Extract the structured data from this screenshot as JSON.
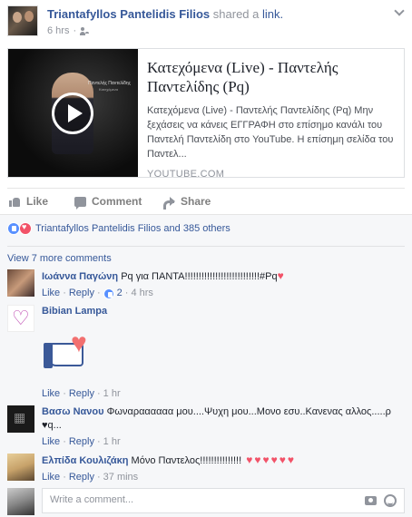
{
  "post": {
    "author": "Triantafyllos Pantelidis Filios",
    "action_text": "shared a",
    "action_link": "link.",
    "time": "6 hrs",
    "audience_icon": "friends-icon",
    "menu_icon": "chevron-down-icon"
  },
  "link_preview": {
    "title": "Κατεχόμενα (Live) - Παντελής Παντελίδης (Pq)",
    "description": "Κατεχόμενα (Live) - Παντελής Παντελίδης (Pq) Μην ξεχάσεις να κάνεις ΕΓΓΡΑΦΗ στο επίσημο κανάλι του Παντελή Παντελίδη στο YouTube. Η επίσημη σελίδα του Παντελ...",
    "domain": "YOUTUBE.COM",
    "thumb_caption": "Παντελής Παντελίδης",
    "thumb_subcaption": "Κατεχόμενα"
  },
  "actions": {
    "like": "Like",
    "comment": "Comment",
    "share": "Share"
  },
  "reactions": {
    "summary": "Triantafyllos Pantelidis Filios and 385 others"
  },
  "view_more": "View 7 more comments",
  "comments": [
    {
      "name": "Ιωάννα Παγώνη",
      "text": "Pq για ΠΑΝΤΑ!!!!!!!!!!!!!!!!!!!!!!!!!!!#Pq",
      "like": "Like",
      "reply": "Reply",
      "likes": "2",
      "time": "4 hrs"
    },
    {
      "name": "Bibian Lampa",
      "text": "",
      "like": "Like",
      "reply": "Reply",
      "time": "1 hr"
    },
    {
      "name": "Βασω Νανου",
      "text": "Φωναραααααα μου....Ψυχη μου...Μονο εσυ..Κανενας αλλος.....ρ ♥q...",
      "like": "Like",
      "reply": "Reply",
      "time": "1 hr"
    },
    {
      "name": "Ελπίδα Κουλιζάκη",
      "text": "Μόνο Παντελος!!!!!!!!!!!!!!!",
      "like": "Like",
      "reply": "Reply",
      "time": "37 mins"
    }
  ],
  "write_comment": {
    "placeholder": "Write a comment..."
  },
  "colors": {
    "link_blue": "#365899",
    "muted": "#90949c",
    "love": "#f25268"
  }
}
